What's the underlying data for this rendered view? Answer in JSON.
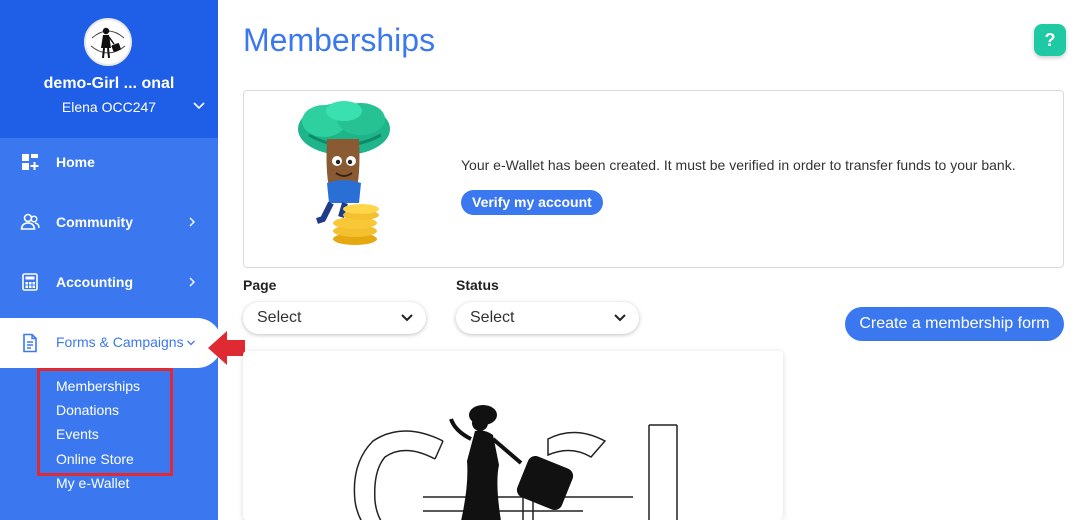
{
  "sidebar": {
    "org_name": "demo-Girl ...  onal",
    "org_user": "Elena OCC247",
    "nav": [
      {
        "label": "Home",
        "icon": "dashboard-icon"
      },
      {
        "label": "Community",
        "icon": "people-icon"
      },
      {
        "label": "Accounting",
        "icon": "calculator-icon"
      }
    ],
    "active": {
      "label": "Forms & Campaigns",
      "icon": "document-icon"
    },
    "sub_items": [
      "Memberships",
      "Donations",
      "Events",
      "Online Store",
      "My e-Wallet"
    ]
  },
  "main": {
    "title": "Memberships",
    "help": "?",
    "wallet": {
      "message": "Your e-Wallet has been created. It must be verified in order to transfer funds to your bank.",
      "verify_label": "Verify my account"
    },
    "filters": {
      "page_label": "Page",
      "page_value": "Select",
      "status_label": "Status",
      "status_value": "Select"
    },
    "create_label": "Create a membership form"
  },
  "colors": {
    "accent": "#3b78f0",
    "sidebar_top": "#1f5ee6",
    "help": "#1fc9a4",
    "highlight": "#e02a33"
  }
}
